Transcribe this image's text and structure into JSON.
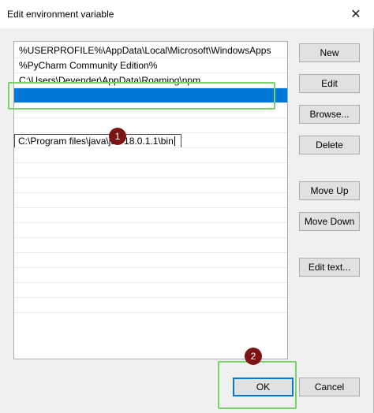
{
  "window": {
    "title": "Edit environment variable",
    "close_glyph": "✕"
  },
  "list": {
    "items": [
      "%USERPROFILE%\\AppData\\Local\\Microsoft\\WindowsApps",
      "%PyCharm Community Edition%",
      "C:\\Users\\Devender\\AppData\\Roaming\\npm"
    ],
    "editing_value": "C:\\Program files\\java\\jdk-18.0.1.1\\bin"
  },
  "buttons": {
    "new": "New",
    "edit": "Edit",
    "browse": "Browse...",
    "delete": "Delete",
    "move_up": "Move Up",
    "move_down": "Move Down",
    "edit_text": "Edit text...",
    "ok": "OK",
    "cancel": "Cancel"
  },
  "annotations": {
    "step1": "1",
    "step2": "2",
    "highlight_color": "#7cd26a",
    "marker_color": "#7b1414"
  },
  "colors": {
    "selection": "#0078d7",
    "button_bg": "#e1e1e1",
    "dialog_bg": "#f0f0f0"
  }
}
